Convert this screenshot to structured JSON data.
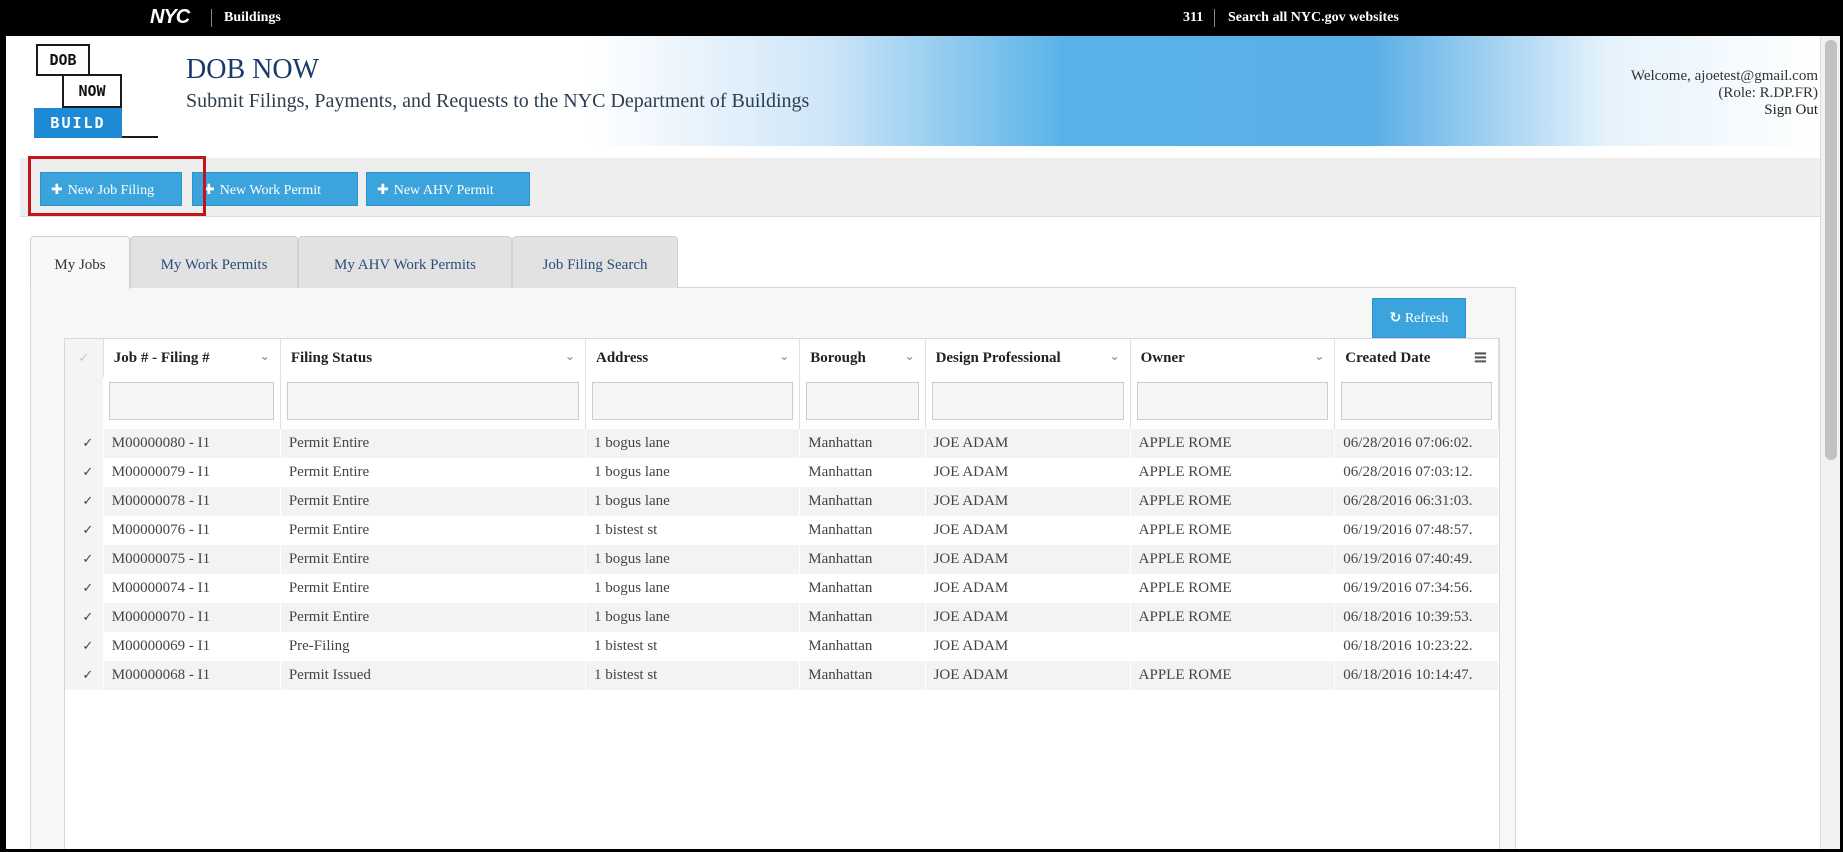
{
  "nycbar": {
    "logo": "NYC",
    "section": "Buildings",
    "link_311": "311",
    "search_link": "Search all NYC.gov websites"
  },
  "header": {
    "logo_lines": [
      "DOB",
      "NOW",
      "BUILD"
    ],
    "title": "DOB NOW",
    "subtitle": "Submit Filings, Payments, and Requests to the NYC Department of Buildings",
    "welcome": "Welcome, ajoetest@gmail.com",
    "role": "(Role: R.DP.FR)",
    "signout": "Sign Out"
  },
  "actions": {
    "new_job_filing": "New Job Filing",
    "new_work_permit": "New Work Permit",
    "new_ahv_permit": "New AHV Permit"
  },
  "tabs": [
    "My Jobs",
    "My Work Permits",
    "My AHV Work Permits",
    "Job Filing Search"
  ],
  "refresh_label": "Refresh",
  "grid": {
    "columns": [
      "Job # - Filing #",
      "Filing Status",
      "Address",
      "Borough",
      "Design Professional",
      "Owner",
      "Created Date"
    ],
    "rows": [
      [
        "M00000080 - I1",
        "Permit Entire",
        "1 bogus lane",
        "Manhattan",
        "JOE ADAM",
        "APPLE ROME",
        "06/28/2016 07:06:02."
      ],
      [
        "M00000079 - I1",
        "Permit Entire",
        "1 bogus lane",
        "Manhattan",
        "JOE ADAM",
        "APPLE ROME",
        "06/28/2016 07:03:12."
      ],
      [
        "M00000078 - I1",
        "Permit Entire",
        "1 bogus lane",
        "Manhattan",
        "JOE ADAM",
        "APPLE ROME",
        "06/28/2016 06:31:03."
      ],
      [
        "M00000076 - I1",
        "Permit Entire",
        "1 bistest st",
        "Manhattan",
        "JOE ADAM",
        "APPLE ROME",
        "06/19/2016 07:48:57."
      ],
      [
        "M00000075 - I1",
        "Permit Entire",
        "1 bogus lane",
        "Manhattan",
        "JOE ADAM",
        "APPLE ROME",
        "06/19/2016 07:40:49."
      ],
      [
        "M00000074 - I1",
        "Permit Entire",
        "1 bogus lane",
        "Manhattan",
        "JOE ADAM",
        "APPLE ROME",
        "06/19/2016 07:34:56."
      ],
      [
        "M00000070 - I1",
        "Permit Entire",
        "1 bogus lane",
        "Manhattan",
        "JOE ADAM",
        "APPLE ROME",
        "06/18/2016 10:39:53."
      ],
      [
        "M00000069 - I1",
        "Pre-Filing",
        "1 bistest st",
        "Manhattan",
        "JOE ADAM",
        "",
        "06/18/2016 10:23:22."
      ],
      [
        "M00000068 - I1",
        "Permit Issued",
        "1 bistest st",
        "Manhattan",
        "JOE ADAM",
        "APPLE ROME",
        "06/18/2016 10:14:47."
      ]
    ]
  },
  "icons": {
    "plus": "plus-icon",
    "refresh": "refresh-icon",
    "menu": "hamburger-menu-icon",
    "chevron": "chevron-down-icon",
    "check": "check-icon"
  },
  "colors": {
    "accent": "#3ba4dc",
    "highlight": "#c0151b",
    "tab_text": "#2a4d7c"
  }
}
